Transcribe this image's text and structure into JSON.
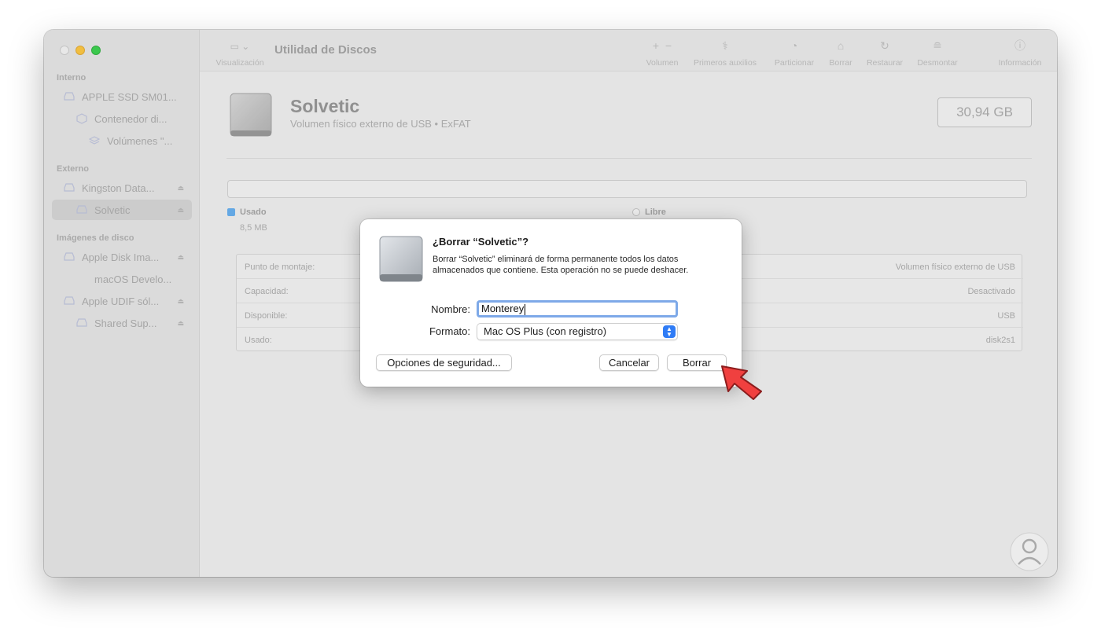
{
  "app": {
    "title": "Utilidad de Discos"
  },
  "sidebar": {
    "sections": [
      {
        "title": "Interno"
      },
      {
        "title": "Externo"
      },
      {
        "title": "Imágenes de disco"
      }
    ],
    "items": [
      {
        "label": "APPLE SSD SM01...",
        "icon": "drive-icon"
      },
      {
        "label": "Contenedor di...",
        "icon": "container-icon"
      },
      {
        "label": "Volúmenes \"...",
        "icon": "volume-stack-icon"
      },
      {
        "label": "Kingston Data...",
        "icon": "drive-icon"
      },
      {
        "label": "Solvetic",
        "icon": "drive-icon"
      },
      {
        "label": "Apple Disk Ima...",
        "icon": "drive-icon"
      },
      {
        "label": "macOS Develo...",
        "icon": "volume-icon"
      },
      {
        "label": "Apple UDIF sól...",
        "icon": "drive-icon"
      },
      {
        "label": "Shared Sup...",
        "icon": "volume-icon"
      }
    ]
  },
  "toolbar": {
    "view_label": "Visualización",
    "volume_label": "Volumen",
    "first_aid_label": "Primeros auxilios",
    "partition_label": "Particionar",
    "erase_label": "Borrar",
    "restore_label": "Restaurar",
    "unmount_label": "Desmontar",
    "info_label": "Información"
  },
  "volume": {
    "name": "Solvetic",
    "subtitle": "Volumen físico externo de USB • ExFAT",
    "size": "30,94 GB",
    "used_label": "Usado",
    "used_value": "8,5 MB",
    "free_label": "Libre"
  },
  "info_table": {
    "rows": [
      {
        "key": "Punto de montaje:",
        "value": "Volumen físico externo de USB"
      },
      {
        "key": "Capacidad:",
        "value": "Desactivado"
      },
      {
        "key": "Disponible:",
        "value": "USB"
      },
      {
        "key": "Usado:",
        "value": "disk2s1"
      }
    ]
  },
  "dialog": {
    "title": "¿Borrar “Solvetic”?",
    "message": "Borrar “Solvetic” eliminará de forma permanente todos los datos almacenados que contiene. Esta operación no se puede deshacer.",
    "name_label": "Nombre:",
    "name_value": "Monterey",
    "format_label": "Formato:",
    "format_value": "Mac OS Plus (con registro)",
    "security_button": "Opciones de seguridad...",
    "cancel_button": "Cancelar",
    "erase_button": "Borrar"
  },
  "colors": {
    "used_swatch": "#5aa5e8",
    "accent": "#2f7cf6",
    "arrow": "#f0403f"
  }
}
